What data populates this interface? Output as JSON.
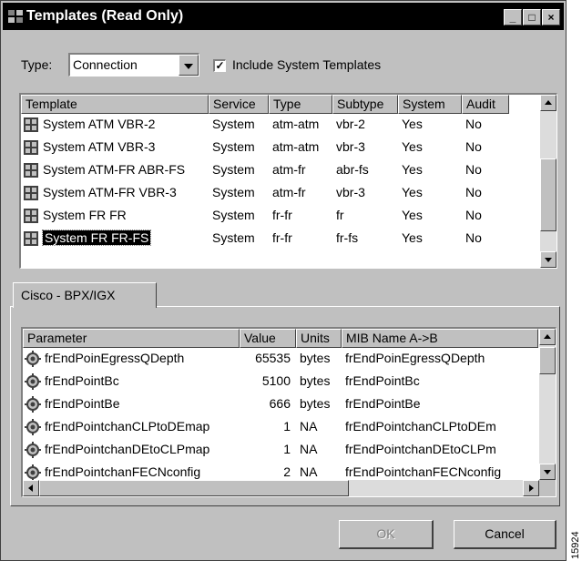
{
  "window": {
    "title": "Templates (Read Only)",
    "min": "_",
    "max": "□",
    "close": "×"
  },
  "filter": {
    "type_label": "Type:",
    "type_value": "Connection",
    "include_label": "Include System Templates",
    "include_checked": "✓"
  },
  "templates": {
    "columns": [
      "Template",
      "Service",
      "Type",
      "Subtype",
      "System",
      "Audit"
    ],
    "rows": [
      {
        "template": "System ATM VBR-2",
        "service": "System",
        "type": "atm-atm",
        "subtype": "vbr-2",
        "system": "Yes",
        "audit": "No"
      },
      {
        "template": "System ATM VBR-3",
        "service": "System",
        "type": "atm-atm",
        "subtype": "vbr-3",
        "system": "Yes",
        "audit": "No"
      },
      {
        "template": "System ATM-FR ABR-FS",
        "service": "System",
        "type": "atm-fr",
        "subtype": "abr-fs",
        "system": "Yes",
        "audit": "No"
      },
      {
        "template": "System ATM-FR VBR-3",
        "service": "System",
        "type": "atm-fr",
        "subtype": "vbr-3",
        "system": "Yes",
        "audit": "No"
      },
      {
        "template": "System FR FR",
        "service": "System",
        "type": "fr-fr",
        "subtype": "fr",
        "system": "Yes",
        "audit": "No"
      },
      {
        "template": "System FR FR-FS",
        "service": "System",
        "type": "fr-fr",
        "subtype": "fr-fs",
        "system": "Yes",
        "audit": "No"
      }
    ],
    "selected_row": 5,
    "row_icon": "template-grid-icon"
  },
  "tab": {
    "label": "Cisco - BPX/IGX"
  },
  "parameters": {
    "columns": [
      "Parameter",
      "Value",
      "Units",
      "MIB Name A->B"
    ],
    "rows": [
      {
        "parameter": "frEndPoinEgressQDepth",
        "value": "65535",
        "units": "bytes",
        "mib": "frEndPoinEgressQDepth"
      },
      {
        "parameter": "frEndPointBc",
        "value": "5100",
        "units": "bytes",
        "mib": "frEndPointBc"
      },
      {
        "parameter": "frEndPointBe",
        "value": "666",
        "units": "bytes",
        "mib": "frEndPointBe"
      },
      {
        "parameter": "frEndPointchanCLPtoDEmap",
        "value": "1",
        "units": "NA",
        "mib": "frEndPointchanCLPtoDEm"
      },
      {
        "parameter": "frEndPointchanDEtoCLPmap",
        "value": "1",
        "units": "NA",
        "mib": "frEndPointchanDEtoCLPm"
      },
      {
        "parameter": "frEndPointchanFECNconfig",
        "value": "2",
        "units": "NA",
        "mib": "frEndPointchanFECNconfig"
      }
    ],
    "row_icon": "gear-icon"
  },
  "buttons": {
    "ok": "OK",
    "cancel": "Cancel"
  },
  "side_label": "15924"
}
